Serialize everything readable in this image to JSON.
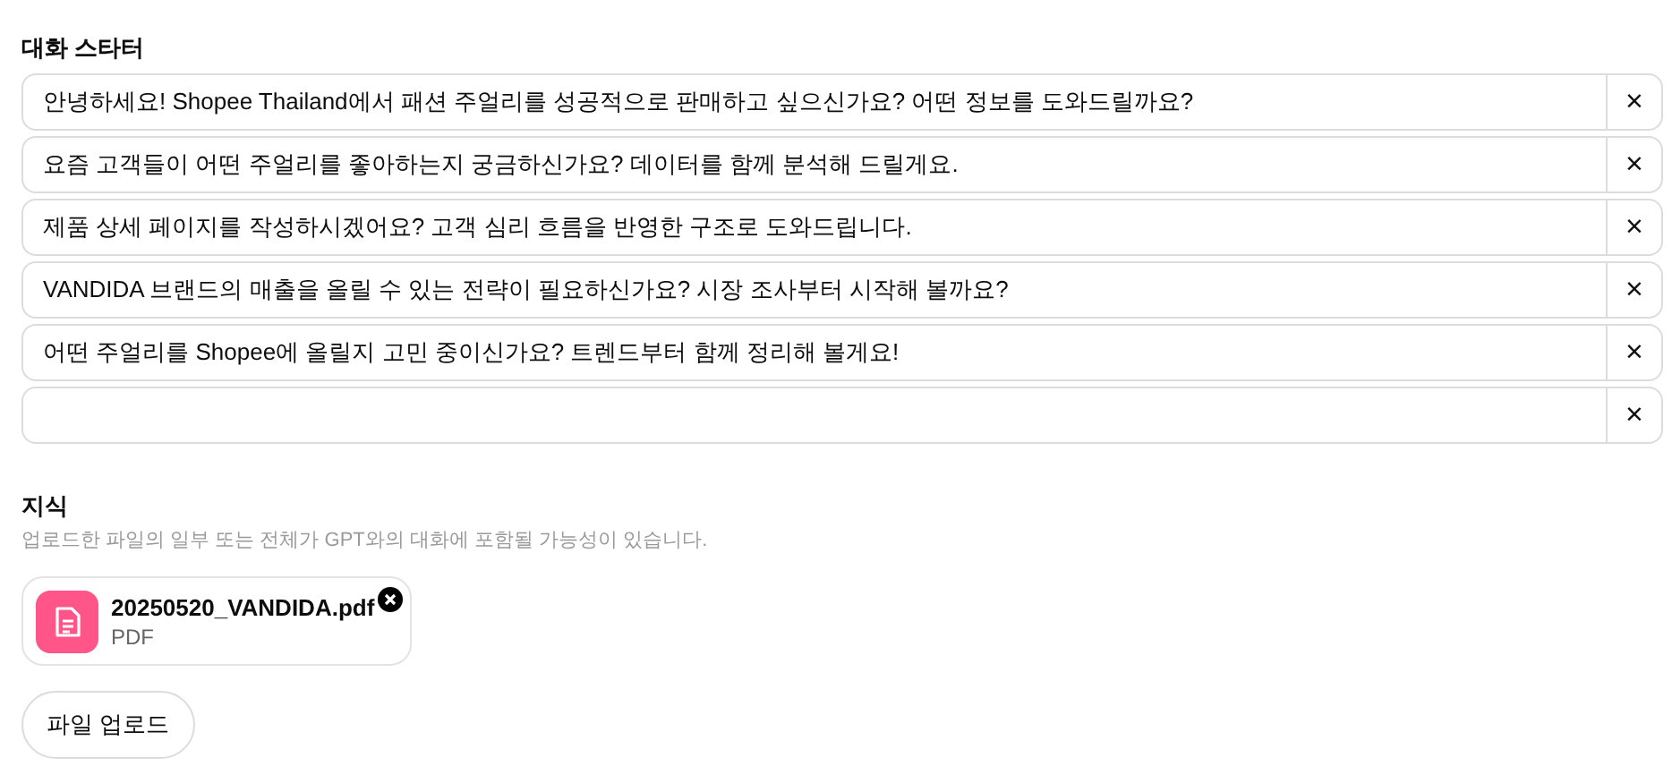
{
  "starters": {
    "title": "대화 스타터",
    "items": [
      {
        "value": "안녕하세요! Shopee Thailand에서 패션 주얼리를 성공적으로 판매하고 싶으신가요? 어떤 정보를 도와드릴까요?",
        "remove": "×"
      },
      {
        "value": "요즘 고객들이 어떤 주얼리를 좋아하는지 궁금하신가요? 데이터를 함께 분석해 드릴게요.",
        "remove": "×"
      },
      {
        "value": "제품 상세 페이지를 작성하시겠어요? 고객 심리 흐름을 반영한 구조로 도와드립니다.",
        "remove": "×"
      },
      {
        "value": "VANDIDA 브랜드의 매출을 올릴 수 있는 전략이 필요하신가요? 시장 조사부터 시작해 볼까요?",
        "remove": "×"
      },
      {
        "value": "어떤 주얼리를 Shopee에 올릴지 고민 중이신가요? 트렌드부터 함께 정리해 볼게요!",
        "remove": "×"
      },
      {
        "remove": "×"
      }
    ]
  },
  "knowledge": {
    "title": "지식",
    "description": "업로드한 파일의 일부 또는 전체가 GPT와의 대화에 포함될 가능성이 있습니다.",
    "files": [
      {
        "name": "20250520_VANDIDA.pdf",
        "type": "PDF",
        "color": "#ff5588"
      }
    ],
    "upload_button": "파일 업로드"
  }
}
